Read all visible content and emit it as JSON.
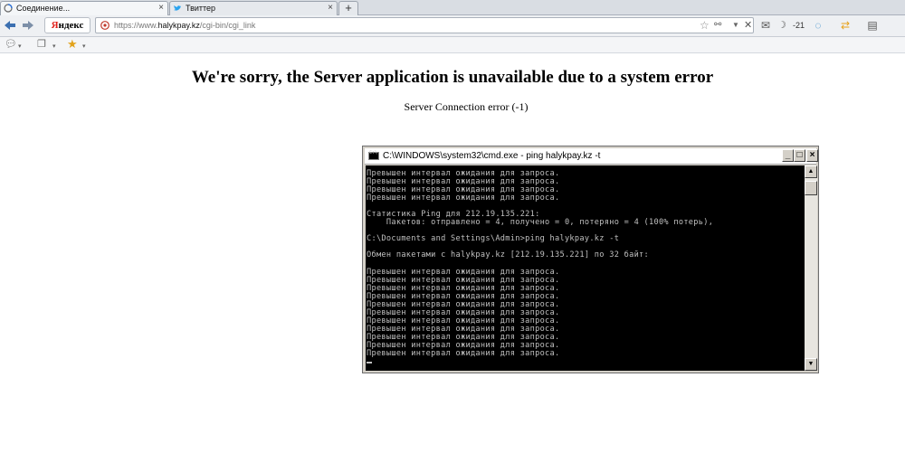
{
  "browser": {
    "tabs": [
      {
        "title": "Соединение...",
        "active": true
      },
      {
        "title": "Твиттер",
        "active": false
      }
    ],
    "new_tab_label": "+",
    "yandex_label_y": "Я",
    "yandex_label_rest": "ндекс",
    "url_prefix": "https://www.",
    "url_host": "halykpay.kz",
    "url_path": "/cgi-bin/cgi_link",
    "weather_temp": "-21",
    "accent_color": "#e0201b"
  },
  "page": {
    "title": "We're sorry, the Server application is unavailable due to a system error",
    "message": "Server Connection error (-1)"
  },
  "console": {
    "title": "C:\\WINDOWS\\system32\\cmd.exe - ping halykpay.kz -t",
    "minimize_label": "_",
    "maximize_label": "□",
    "close_label": "×",
    "lines": [
      "Превышен интервал ожидания для запроса.",
      "Превышен интервал ожидания для запроса.",
      "Превышен интервал ожидания для запроса.",
      "Превышен интервал ожидания для запроса.",
      "",
      "Статистика Ping для 212.19.135.221:",
      "    Пакетов: отправлено = 4, получено = 0, потеряно = 4 (100% потерь),",
      "",
      "C:\\Documents and Settings\\Admin>ping halykpay.kz -t",
      "",
      "Обмен пакетами с halykpay.kz [212.19.135.221] по 32 байт:",
      "",
      "Превышен интервал ожидания для запроса.",
      "Превышен интервал ожидания для запроса.",
      "Превышен интервал ожидания для запроса.",
      "Превышен интервал ожидания для запроса.",
      "Превышен интервал ожидания для запроса.",
      "Превышен интервал ожидания для запроса.",
      "Превышен интервал ожидания для запроса.",
      "Превышен интервал ожидания для запроса.",
      "Превышен интервал ожидания для запроса.",
      "Превышен интервал ожидания для запроса.",
      "Превышен интервал ожидания для запроса."
    ]
  }
}
